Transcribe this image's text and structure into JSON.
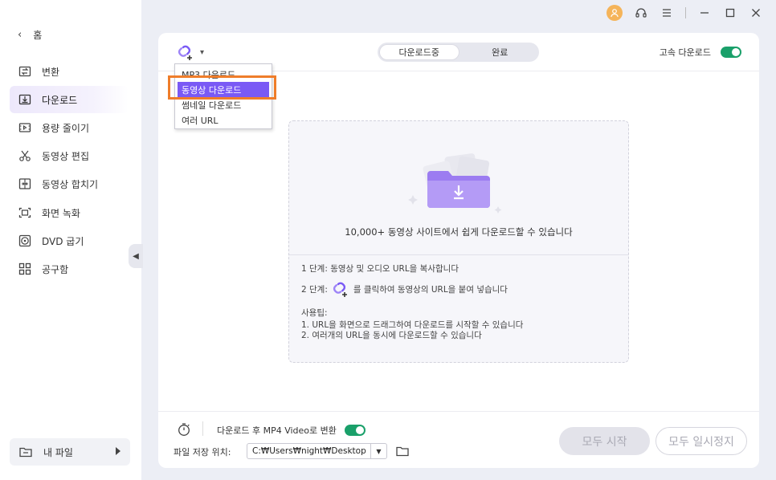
{
  "sidebar": {
    "home_label": "홈",
    "items": [
      {
        "label": "변환",
        "icon": "convert-icon"
      },
      {
        "label": "다운로드",
        "icon": "download-icon",
        "active": true
      },
      {
        "label": "용량 줄이기",
        "icon": "compress-icon"
      },
      {
        "label": "동영상 편집",
        "icon": "scissors-icon"
      },
      {
        "label": "동영상 합치기",
        "icon": "merge-icon"
      },
      {
        "label": "화면 녹화",
        "icon": "screen-record-icon"
      },
      {
        "label": "DVD 굽기",
        "icon": "dvd-icon"
      },
      {
        "label": "공구함",
        "icon": "toolbox-icon"
      }
    ],
    "my_files_label": "내 파일"
  },
  "tabs": {
    "downloading": "다운로드중",
    "completed": "완료"
  },
  "high_speed": {
    "label": "고속 다운로드",
    "enabled": true
  },
  "dropdown": {
    "items": [
      "MP3 다운로드",
      "동영상 다운로드",
      "썸네일 다운로드",
      "여러 URL"
    ],
    "selected_index": 1
  },
  "dropzone": {
    "title": "10,000+ 동영상 사이트에서 쉽게 다운로드할 수 있습니다",
    "step1": "1 단계: 동영상 및 오디오 URL을 복사합니다",
    "step2_prefix": "2 단계:",
    "step2_suffix": "를 클릭하여 동영상의 URL을 붙여 넣습니다",
    "tips_heading": "사용팁:",
    "tip1": "1. URL을 화면으로 드래그하여 다운로드를 시작할 수 있습니다",
    "tip2": "2. 여러개의 URL을 동시에 다운로드할 수 있습니다"
  },
  "bottom": {
    "convert_label": "다운로드 후 MP4 Video로 변환",
    "convert_enabled": true,
    "save_location_label": "파일 저장 위치:",
    "save_path": "C:₩Users₩night₩Desktop",
    "start_all": "모두 시작",
    "pause_all": "모두 일시정지"
  },
  "colors": {
    "accent_purple": "#7a5af5",
    "toggle_green": "#1aa06a",
    "highlight_orange": "#ef7d2a",
    "avatar_orange": "#f5b45a"
  }
}
